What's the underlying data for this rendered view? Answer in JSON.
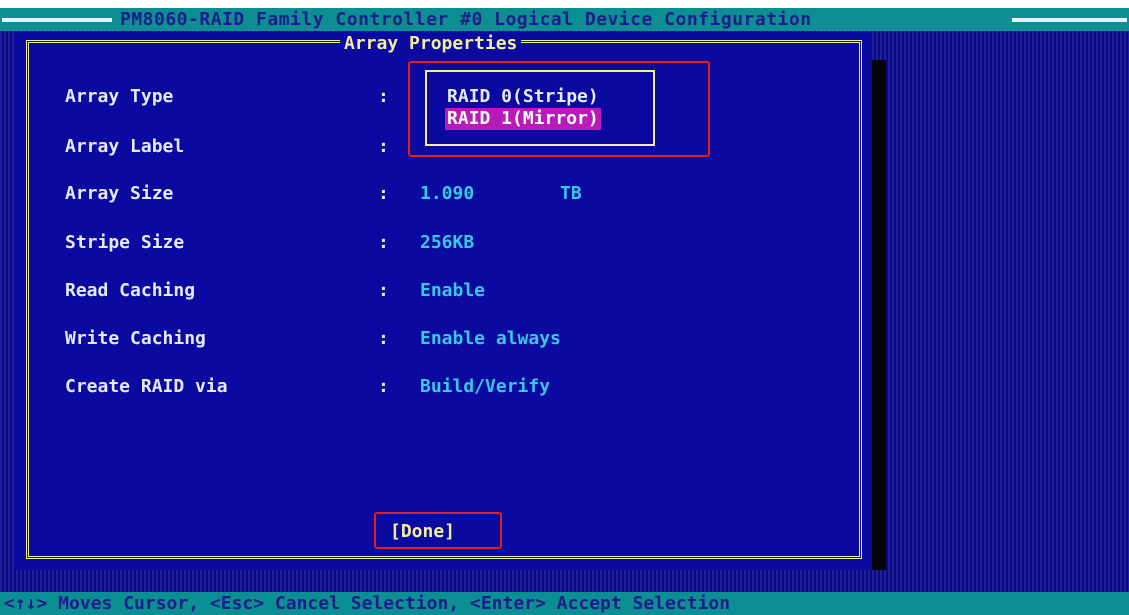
{
  "title_bar": {
    "title": "PM8060-RAID Family Controller #0 Logical Device Configuration"
  },
  "dialog": {
    "title": "Array Properties",
    "fields": [
      {
        "label": "Array Type",
        "colon": ":",
        "value": "",
        "unit": ""
      },
      {
        "label": "Array Label",
        "colon": ":",
        "value": "",
        "unit": ""
      },
      {
        "label": "Array Size",
        "colon": ":",
        "value": "1.090",
        "unit": "TB"
      },
      {
        "label": "Stripe Size",
        "colon": ":",
        "value": "256KB",
        "unit": ""
      },
      {
        "label": "Read Caching",
        "colon": ":",
        "value": "Enable",
        "unit": ""
      },
      {
        "label": "Write Caching",
        "colon": ":",
        "value": "Enable always",
        "unit": ""
      },
      {
        "label": "Create RAID via",
        "colon": ":",
        "value": "Build/Verify",
        "unit": ""
      }
    ],
    "popup": {
      "options": [
        "RAID 0(Stripe)",
        "RAID 1(Mirror)"
      ],
      "selected": "RAID 1(Mirror)"
    },
    "done_label": "[Done]"
  },
  "status_bar": {
    "hint": "<↑↓> Moves Cursor, <Esc> Cancel Selection, <Enter> Accept Selection"
  },
  "colors": {
    "background": "#0c0c8e",
    "dialog": "#0a0aa0",
    "frame": "#f2ee9a",
    "value_text": "#38c8e8",
    "label_text": "#e4ebff",
    "highlight": "#b81cb8",
    "title_bar": "#0b8f92",
    "annotation": "#e0201c"
  }
}
